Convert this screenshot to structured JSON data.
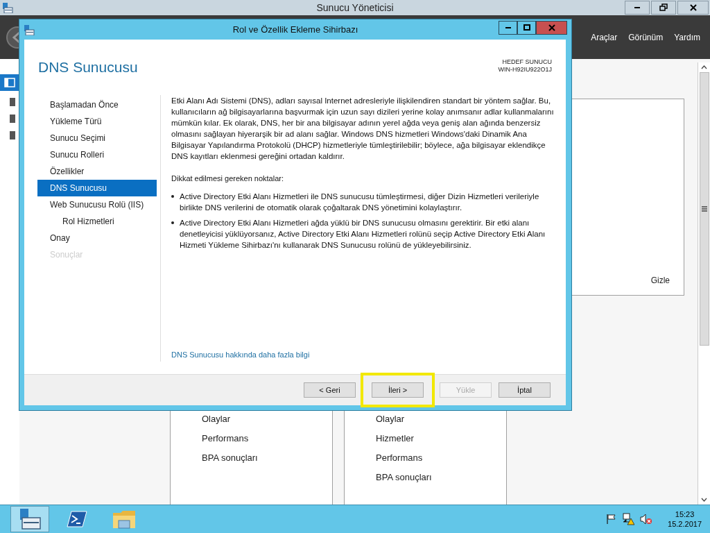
{
  "app_window": {
    "title": "Sunucu Yöneticisi",
    "menu": [
      "Araçlar",
      "Görünüm",
      "Yardım"
    ],
    "hide_link": "Gizle",
    "tiles": [
      {
        "items": [
          "Olaylar",
          "Performans",
          "BPA sonuçları"
        ]
      },
      {
        "items": [
          "Olaylar",
          "Hizmetler",
          "Performans",
          "BPA sonuçları"
        ]
      }
    ]
  },
  "wizard": {
    "title": "Rol ve Özellik Ekleme Sihirbazı",
    "heading": "DNS Sunucusu",
    "target_label": "HEDEF SUNUCU",
    "target_server": "WIN-H92IU922O1J",
    "steps": [
      {
        "label": "Başlamadan Önce",
        "selected": false,
        "disabled": false
      },
      {
        "label": "Yükleme Türü",
        "selected": false,
        "disabled": false
      },
      {
        "label": "Sunucu Seçimi",
        "selected": false,
        "disabled": false
      },
      {
        "label": "Sunucu Rolleri",
        "selected": false,
        "disabled": false
      },
      {
        "label": "Özellikler",
        "selected": false,
        "disabled": false
      },
      {
        "label": "DNS Sunucusu",
        "selected": true,
        "disabled": false
      },
      {
        "label": "Web Sunucusu Rolü (IIS)",
        "selected": false,
        "disabled": false,
        "children": [
          {
            "label": "Rol Hizmetleri",
            "selected": false,
            "disabled": false
          }
        ]
      },
      {
        "label": "Onay",
        "selected": false,
        "disabled": false
      },
      {
        "label": "Sonuçlar",
        "selected": false,
        "disabled": true
      }
    ],
    "description": "Etki Alanı Adı Sistemi (DNS), adları sayısal Internet adresleriyle ilişkilendiren standart bir yöntem sağlar. Bu, kullanıcıların ağ bilgisayarlarına başvurmak için uzun sayı dizileri yerine kolay anımsanır adlar kullanmalarını mümkün kılar. Ek olarak, DNS, her bir ana bilgisayar adının yerel ağda veya geniş alan ağında benzersiz olmasını sağlayan hiyerarşik bir ad alanı sağlar. Windows DNS hizmetleri Windows'daki Dinamik Ana Bilgisayar Yapılandırma Protokolü (DHCP) hizmetleriyle tümleştirilebilir; böylece, ağa bilgisayar eklendikçe DNS kayıtları eklenmesi gereğini ortadan kaldırır.",
    "notes_heading": "Dikkat edilmesi gereken noktalar:",
    "notes": [
      "Active Directory Etki Alanı Hizmetleri ile DNS sunucusu tümleştirmesi, diğer Dizin Hizmetleri verileriyle birlikte DNS verilerini de otomatik olarak çoğaltarak DNS yönetimini kolaylaştırır.",
      "Active Directory Etki Alanı Hizmetleri ağda yüklü bir DNS sunucusu olmasını gerektirir. Bir etki alanı denetleyicisi yüklüyorsanız, Active Directory Etki Alanı Hizmetleri rolünü seçip Active Directory Etki Alanı Hizmeti Yükleme Sihirbazı'nı kullanarak DNS Sunucusu rolünü de yükleyebilirsiniz."
    ],
    "more_info_link": "DNS Sunucusu hakkında daha fazla bilgi",
    "buttons": [
      {
        "label": "< Geri",
        "disabled": false,
        "highlighted": false
      },
      {
        "label": "İleri >",
        "disabled": false,
        "highlighted": true
      },
      {
        "label": "Yükle",
        "disabled": true,
        "highlighted": false
      },
      {
        "label": "İptal",
        "disabled": false,
        "highlighted": false
      }
    ]
  },
  "sidebar": [
    {
      "kind": "dashboard",
      "selected": true
    },
    {
      "kind": "server",
      "selected": false
    },
    {
      "kind": "server",
      "selected": false
    },
    {
      "kind": "server",
      "selected": false
    }
  ],
  "taskbar": {
    "apps": [
      {
        "kind": "servermanager",
        "selected": true
      },
      {
        "kind": "powershell",
        "selected": false
      },
      {
        "kind": "explorer",
        "selected": false
      }
    ],
    "time": "15:23",
    "date": "15.2.2017"
  }
}
